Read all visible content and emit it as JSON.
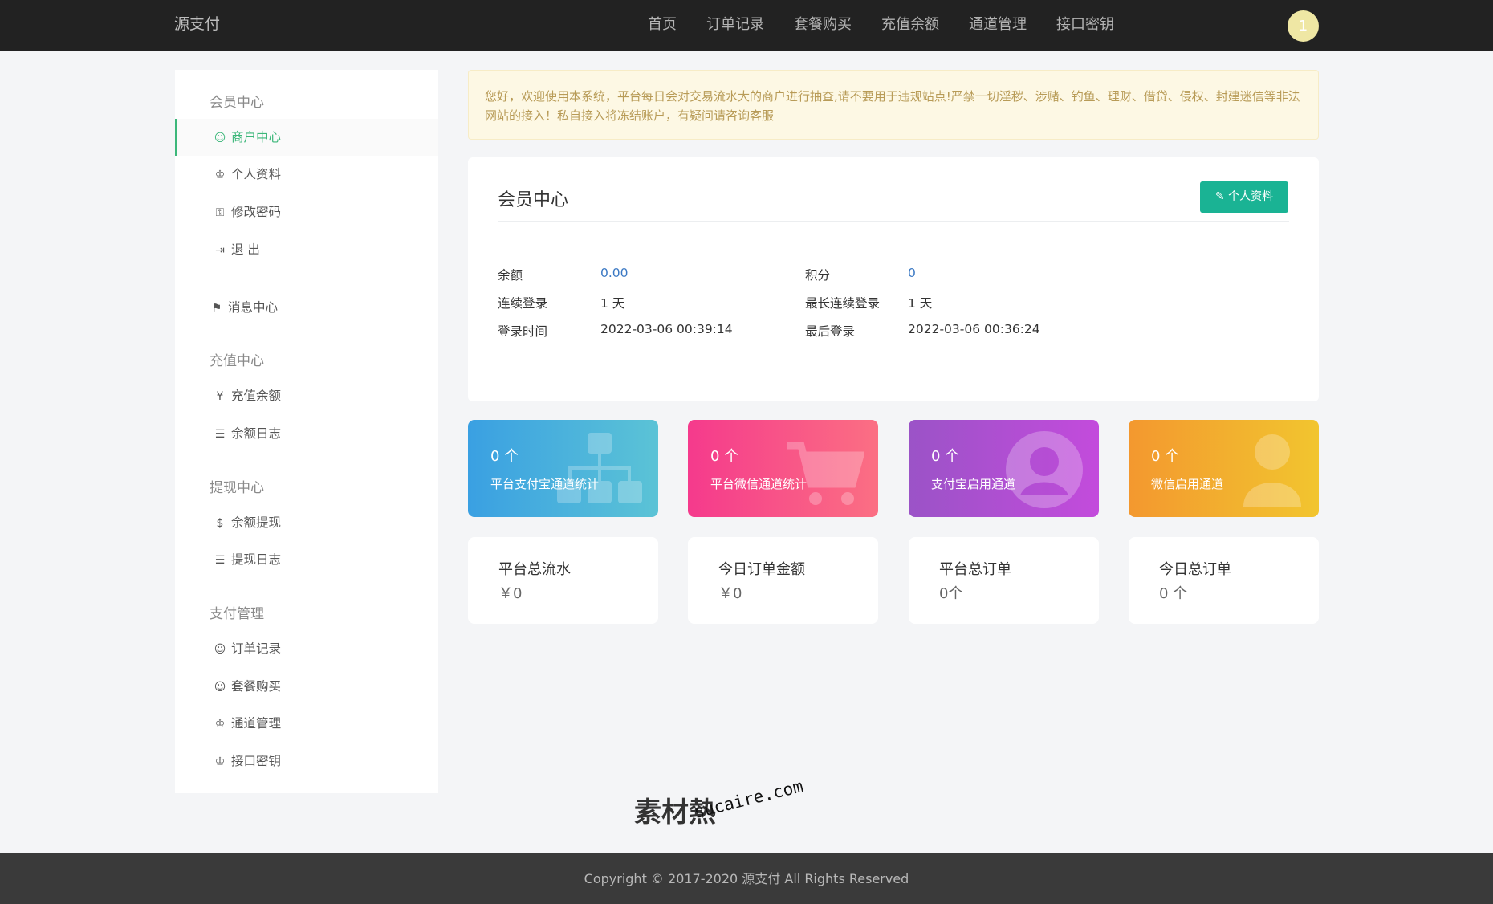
{
  "app": {
    "brand": "源支付",
    "avatar_text": "1"
  },
  "nav": {
    "items": [
      "首页",
      "订单记录",
      "套餐购买",
      "充值余额",
      "通道管理",
      "接口密钥"
    ]
  },
  "sidebar": {
    "groups": [
      {
        "title": "会员中心",
        "items": [
          {
            "label": "商户中心",
            "icon": "user-circle-icon",
            "glyph": "☺",
            "active": true
          },
          {
            "label": "个人资料",
            "icon": "user-icon",
            "glyph": "⚲"
          },
          {
            "label": "修改密码",
            "icon": "key-icon",
            "glyph": "⚷"
          },
          {
            "label": "退 出",
            "icon": "logout-icon",
            "glyph": "⇥"
          }
        ]
      },
      {
        "title": "",
        "items": [
          {
            "label": "消息中心",
            "icon": "megaphone-icon",
            "glyph": "📢"
          }
        ]
      },
      {
        "title": "充值中心",
        "items": [
          {
            "label": "充值余额",
            "icon": "yen-icon",
            "glyph": "¥"
          },
          {
            "label": "余额日志",
            "icon": "list-icon",
            "glyph": "☰"
          }
        ]
      },
      {
        "title": "提现中心",
        "items": [
          {
            "label": "余额提现",
            "icon": "dollar-icon",
            "glyph": "$"
          },
          {
            "label": "提现日志",
            "icon": "list-icon",
            "glyph": "☰"
          }
        ]
      },
      {
        "title": "支付管理",
        "items": [
          {
            "label": "订单记录",
            "icon": "user-circle-icon",
            "glyph": "☺"
          },
          {
            "label": "套餐购买",
            "icon": "user-circle-icon",
            "glyph": "☺"
          },
          {
            "label": "通道管理",
            "icon": "user-icon",
            "glyph": "⚲"
          },
          {
            "label": "接口密钥",
            "icon": "user-icon",
            "glyph": "⚲"
          }
        ]
      }
    ]
  },
  "notice": {
    "text": "您好，欢迎使用本系统，平台每日会对交易流水大的商户进行抽查,请不要用于违规站点!严禁一切淫秽、涉赌、钓鱼、理财、借贷、侵权、封建迷信等非法网站的接入！私自接入将冻结账户，有疑问请咨询客服"
  },
  "member": {
    "title": "会员中心",
    "profile_button": "个人资料",
    "balance_label": "余额",
    "balance": "0.00",
    "points_label": "积分",
    "points": "0",
    "streak_label": "连续登录",
    "streak": "1 天",
    "max_streak_label": "最长连续登录",
    "max_streak": "1 天",
    "login_time_label": "登录时间",
    "login_time": "2022-03-06 00:39:14",
    "last_login_label": "最后登录",
    "last_login": "2022-03-06 00:36:24"
  },
  "tiles": [
    {
      "count": "0 个",
      "label": "平台支付宝通道统计",
      "icon": "sitemap-icon"
    },
    {
      "count": "0 个",
      "label": "平台微信通道统计",
      "icon": "shopping-cart-icon"
    },
    {
      "count": "0 个",
      "label": "支付宝启用通道",
      "icon": "user-circle-icon"
    },
    {
      "count": "0 个",
      "label": "微信启用通道",
      "icon": "user-icon"
    }
  ],
  "summary": [
    {
      "title": "平台总流水",
      "value": "￥0"
    },
    {
      "title": "今日订单金额",
      "value": "￥0"
    },
    {
      "title": "平台总订单",
      "value": "0个"
    },
    {
      "title": "今日总订单",
      "value": "0 个"
    }
  ],
  "watermark": {
    "cn": "素材熱",
    "en": "sucaire.com"
  },
  "footer": {
    "text": "Copyright © 2017-2020 源支付 All Rights Reserved"
  }
}
